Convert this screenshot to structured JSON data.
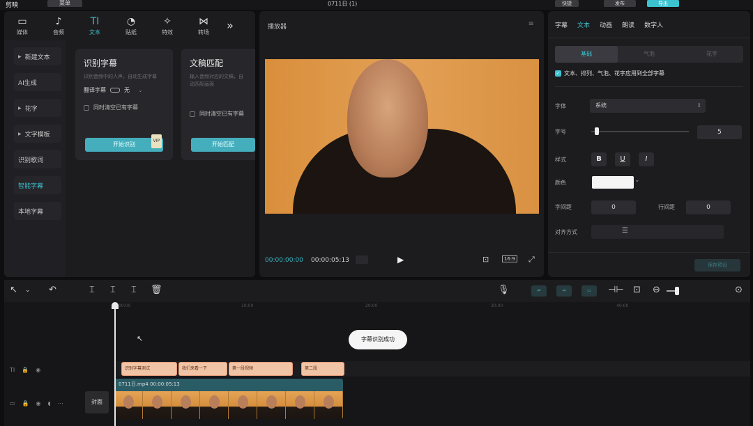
{
  "topbar": {
    "app_name": "剪映",
    "menu_label": "菜单",
    "project_title": "0711日 (1)",
    "shortcut_label": "快捷",
    "export_label": "导出",
    "publish_label": "发布"
  },
  "left_panel": {
    "tools": [
      {
        "icon": "media-icon",
        "glyph": "▭",
        "label": "媒体"
      },
      {
        "icon": "audio-icon",
        "glyph": "♪",
        "label": "音频"
      },
      {
        "icon": "text-icon",
        "glyph": "TI",
        "label": "文本"
      },
      {
        "icon": "sticker-icon",
        "glyph": "◔",
        "label": "贴纸"
      },
      {
        "icon": "effects-icon",
        "glyph": "✧",
        "label": "特效"
      },
      {
        "icon": "transition-icon",
        "glyph": "⋈",
        "label": "转场"
      }
    ],
    "more_glyph": "»",
    "sidebar": [
      {
        "label": "新建文本",
        "expandable": true
      },
      {
        "label": "AI生成",
        "expandable": false
      },
      {
        "label": "花字",
        "expandable": true
      },
      {
        "label": "文字模板",
        "expandable": true
      },
      {
        "label": "识别歌词",
        "expandable": false
      },
      {
        "label": "智能字幕",
        "expandable": false,
        "active": true
      },
      {
        "label": "本地字幕",
        "expandable": false
      }
    ],
    "card_recognize": {
      "title": "识别字幕",
      "desc": "识别音频中的人声，自动生成字幕",
      "translate_label": "翻译字幕",
      "translate_value": "无",
      "clear_label": "同时清空已有字幕",
      "button": "开始识别",
      "vip": "VIP"
    },
    "card_match": {
      "title": "文稿匹配",
      "desc": "输入音频对应的文稿，自动匹配画面",
      "clear_label": "同时清空已有字幕",
      "button": "开始匹配"
    }
  },
  "player": {
    "title": "播放器",
    "current_time": "00:00:00:00",
    "total_time": "00:00:05:13",
    "ratio_label": "16:9"
  },
  "inspector": {
    "tabs": [
      "字幕",
      "文本",
      "动画",
      "朗读",
      "数字人"
    ],
    "active_tab": 1,
    "subtabs": [
      "基础",
      "气泡",
      "花字"
    ],
    "apply_all": "文本、排列、气泡、花字应用到全部字幕",
    "font_label": "字体",
    "font_value": "系统",
    "size_label": "字号",
    "size_value": "5",
    "size_fraction": 0.05,
    "style_label": "样式",
    "style_buttons": [
      "B",
      "U",
      "I"
    ],
    "color_label": "颜色",
    "color_value": "#f4f4f4",
    "char_spacing_label": "字间距",
    "char_spacing_value": "0",
    "line_spacing_label": "行间距",
    "line_spacing_value": "0",
    "align_label": "对齐方式",
    "bottom_button": "保存预设"
  },
  "timeline": {
    "ruler": [
      "00:00",
      "10:00",
      "20:00",
      "30:00",
      "40:00"
    ],
    "toast": "字幕识别成功",
    "captions": [
      "识别字幕测试",
      "我们来看一下",
      "第一段视频",
      "第二段"
    ],
    "video_clip_label": "0711日.mp4  00:00:05:13",
    "cover_label": "封面"
  },
  "colors": {
    "accent": "#3bc3d0",
    "panel": "#1c1c1f",
    "caption": "#f1c4a6"
  }
}
